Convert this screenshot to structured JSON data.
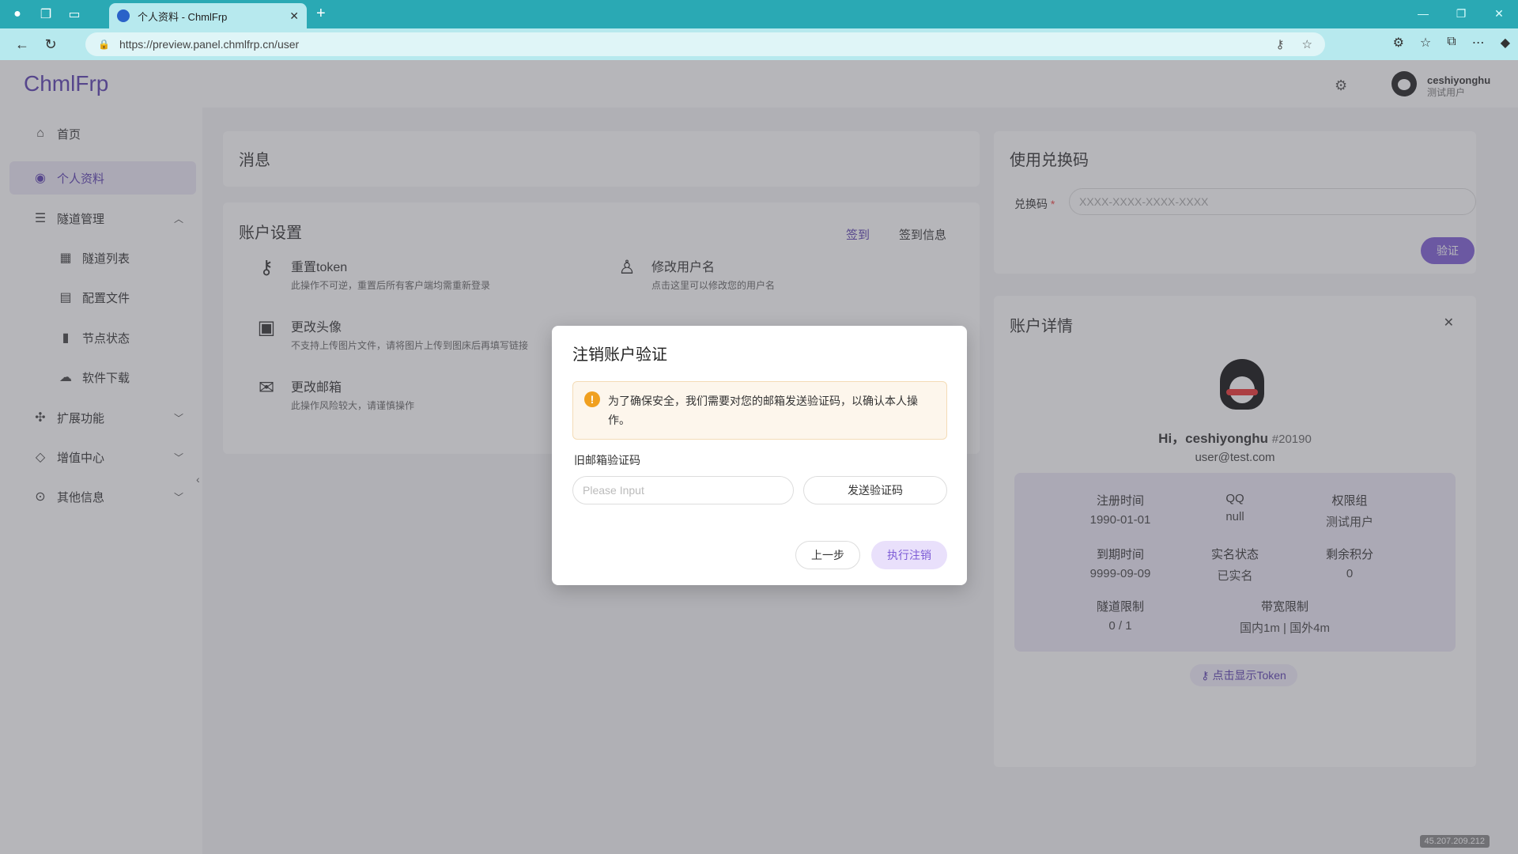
{
  "browser": {
    "tab_title": "个人资料 - ChmlFrp",
    "url": "https://preview.panel.chmlfrp.cn/user",
    "new_tab_symbol": "+"
  },
  "header": {
    "logo": "ChmlFrp",
    "username": "ceshiyonghu",
    "user_group": "测试用户"
  },
  "sidebar": {
    "items": [
      {
        "label": "首页",
        "icon": "home-icon"
      },
      {
        "label": "个人资料",
        "icon": "user-circle-icon"
      },
      {
        "label": "隧道管理",
        "icon": "list-icon"
      },
      {
        "label": "隧道列表",
        "icon": "grid-icon"
      },
      {
        "label": "配置文件",
        "icon": "file-icon"
      },
      {
        "label": "节点状态",
        "icon": "bar-chart-icon"
      },
      {
        "label": "软件下载",
        "icon": "cloud-download-icon"
      },
      {
        "label": "扩展功能",
        "icon": "puzzle-icon"
      },
      {
        "label": "增值中心",
        "icon": "diamond-icon"
      },
      {
        "label": "其他信息",
        "icon": "more-icon"
      }
    ]
  },
  "messages": {
    "title": "消息"
  },
  "account_settings": {
    "title": "账户设置",
    "signin": "签到",
    "signin_info": "签到信息",
    "items": [
      {
        "title": "重置token",
        "desc": "此操作不可逆，重置后所有客户端均需重新登录"
      },
      {
        "title": "修改用户名",
        "desc": "点击这里可以修改您的用户名"
      },
      {
        "title": "更改头像",
        "desc": "不支持上传图片文件，请将图片上传到图床后再填写链接"
      },
      {
        "title": "更改邮箱",
        "desc": "此操作风险较大，请谨慎操作"
      }
    ]
  },
  "redeem": {
    "title": "使用兑换码",
    "label": "兑换码",
    "required_mark": "*",
    "placeholder": "XXXX-XXXX-XXXX-XXXX",
    "verify": "验证"
  },
  "detail": {
    "title": "账户详情",
    "hi": "Hi，ceshiyonghu",
    "uid": "#20190",
    "email": "user@test.com",
    "stats": [
      {
        "k": "注册时间",
        "v": "1990-01-01"
      },
      {
        "k": "QQ",
        "v": "null"
      },
      {
        "k": "权限组",
        "v": "测试用户"
      },
      {
        "k": "到期时间",
        "v": "9999-09-09"
      },
      {
        "k": "实名状态",
        "v": "已实名"
      },
      {
        "k": "剩余积分",
        "v": "0"
      },
      {
        "k": "隧道限制",
        "v": "0 / 1"
      },
      {
        "k": "带宽限制",
        "v": "国内1m | 国外4m"
      }
    ],
    "token_btn": "点击显示Token"
  },
  "modal": {
    "title": "注销账户验证",
    "alert": "为了确保安全，我们需要对您的邮箱发送验证码，以确认本人操作。",
    "code_label": "旧邮箱验证码",
    "code_placeholder": "Please Input",
    "send": "发送验证码",
    "prev": "上一步",
    "execute": "执行注销"
  },
  "ip_badge": "45.207.209.212"
}
